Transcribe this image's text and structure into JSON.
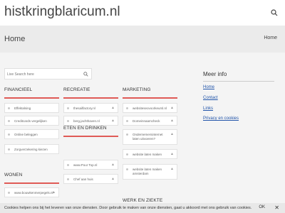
{
  "site": {
    "title": "histkringblaricum.nl"
  },
  "band": {
    "title": "Home",
    "crumb": "Home"
  },
  "search": {
    "placeholder": "Live Search here"
  },
  "categories": {
    "financieel": {
      "title": "FINANCIEEL",
      "links": [
        "Effektalsing",
        "Creditcards vergelijken",
        "Online beleggen",
        "Zorgverzekering kiezen"
      ]
    },
    "recreatie": {
      "title": "RECREATIE",
      "links": [
        "thesailfactory.nl",
        "berg.jachthaven.nl"
      ]
    },
    "marketing": {
      "title": "MARKETING",
      "links": [
        "websiteseovoorkeursl.nl",
        "Domeinnaamcheck",
        "Ondernemersinternet laten uitvoeren?",
        "website laten maken",
        "website laten maken amsterdam"
      ]
    },
    "eten": {
      "title": "ETEN EN DRINKEN",
      "links": [
        "www.Pour Top.nl",
        "Chef aan huis"
      ]
    },
    "wonen": {
      "title": "WONEN",
      "links": [
        "www.bouwkenmerpegels.nl"
      ]
    },
    "werk": {
      "title": "WERK EN ZIEKTE"
    }
  },
  "sidebar": {
    "title": "Meer info",
    "links": [
      "Home",
      "Contact",
      "Links",
      "Privacy en cookies"
    ]
  },
  "cookie": {
    "text": "Cookies helpen ons bij het leveren van onze diensten. Door gebruik te maken van onze diensten, gaat u akkoord met ons gebruik van cookies.",
    "ok": "OK",
    "close": "✕"
  },
  "colors": {
    "accent": "#e05a56",
    "band": "#ebebeb",
    "main": "#f4f4f4",
    "link": "#2255aa"
  },
  "icons": {
    "search": "search-icon",
    "thumb": "thumbs-up-icon"
  }
}
